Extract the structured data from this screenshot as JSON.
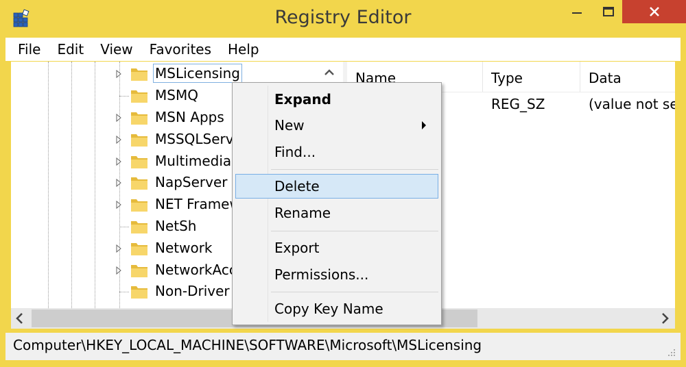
{
  "window": {
    "title": "Registry Editor"
  },
  "menu": [
    "File",
    "Edit",
    "View",
    "Favorites",
    "Help"
  ],
  "tree": {
    "items": [
      {
        "label": "MSLicensing",
        "expandable": true,
        "selected": true
      },
      {
        "label": "MSMQ",
        "expandable": false
      },
      {
        "label": "MSN Apps",
        "expandable": true
      },
      {
        "label": "MSSQLServe",
        "expandable": true
      },
      {
        "label": "Multimedia",
        "expandable": true
      },
      {
        "label": "NapServer",
        "expandable": true
      },
      {
        "label": "NET Framew",
        "expandable": true
      },
      {
        "label": "NetSh",
        "expandable": false
      },
      {
        "label": "Network",
        "expandable": true
      },
      {
        "label": "NetworkAcc",
        "expandable": true
      },
      {
        "label": "Non-Driver S",
        "expandable": false
      }
    ]
  },
  "list": {
    "columns": [
      "Name",
      "Type",
      "Data"
    ],
    "rows": [
      {
        "name": "",
        "type": "REG_SZ",
        "data": "(value not set"
      }
    ]
  },
  "context_menu": {
    "items": [
      "Expand",
      "New",
      "Find...",
      "Delete",
      "Rename",
      "Export",
      "Permissions...",
      "Copy Key Name"
    ],
    "highlighted": "Delete"
  },
  "status": {
    "path": "Computer\\HKEY_LOCAL_MACHINE\\SOFTWARE\\Microsoft\\MSLicensing"
  },
  "icons": {
    "app": "registry-icon",
    "folder": "folder-icon",
    "minimize": "minimize-icon",
    "maximize": "maximize-icon",
    "close": "close-icon"
  },
  "colors": {
    "title_bar": "#f2d64c",
    "close_button": "#c7412f",
    "highlight": "#d6e8f7",
    "highlight_border": "#78aee5"
  }
}
